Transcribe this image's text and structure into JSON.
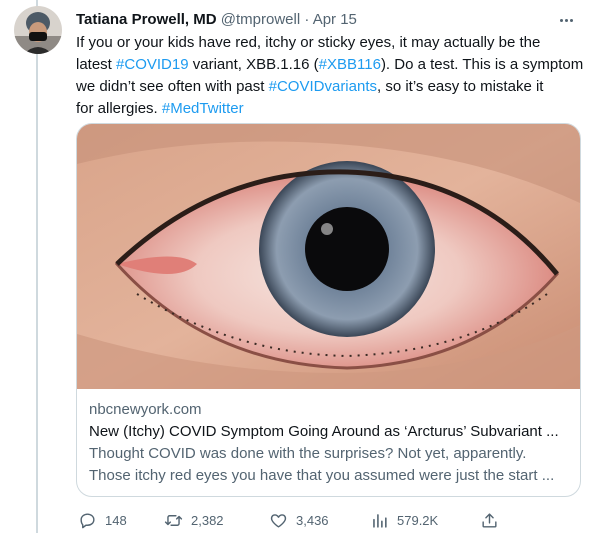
{
  "tweet": {
    "author_name": "Tatiana Prowell, MD",
    "handle": "@tmprowell",
    "separator": "·",
    "date": "Apr 15",
    "text": {
      "line1": "If you or your kids have red, itchy or sticky eyes, it may actually be the",
      "l2_a": "latest ",
      "l2_hashtag": "#COVID19",
      "l2_b": " variant, XBB.1.16 (",
      "l2_hashtag2": "#XBB116",
      "l2_c": "). Do a test. This is a symptom",
      "l3_a": "we didn’t see often with past ",
      "l3_hashtag": "#COVIDvariants",
      "l3_b": ", so it’s easy to mistake it",
      "l4_a": "for allergies. ",
      "l4_hashtag": "#MedTwitter"
    }
  },
  "card": {
    "domain": "nbcnewyork.com",
    "title": "New (Itchy) COVID Symptom Going Around as ‘Arcturus’ Subvariant ...",
    "desc_line1": "Thought COVID was done with the surprises? Not yet, apparently.",
    "desc_line2": "Those itchy red eyes you have that you assumed were just the start ..."
  },
  "actions": {
    "replies": "148",
    "retweets": "2,382",
    "likes": "3,436",
    "views": "579.2K"
  },
  "icons": {
    "reply": "reply-icon",
    "retweet": "retweet-icon",
    "like": "heart-icon",
    "views": "views-icon",
    "share": "share-icon",
    "more": "more-icon"
  },
  "colors": {
    "link": "#1d9bf0",
    "muted": "#536471",
    "text": "#0f1419",
    "border": "#cfd9de"
  }
}
